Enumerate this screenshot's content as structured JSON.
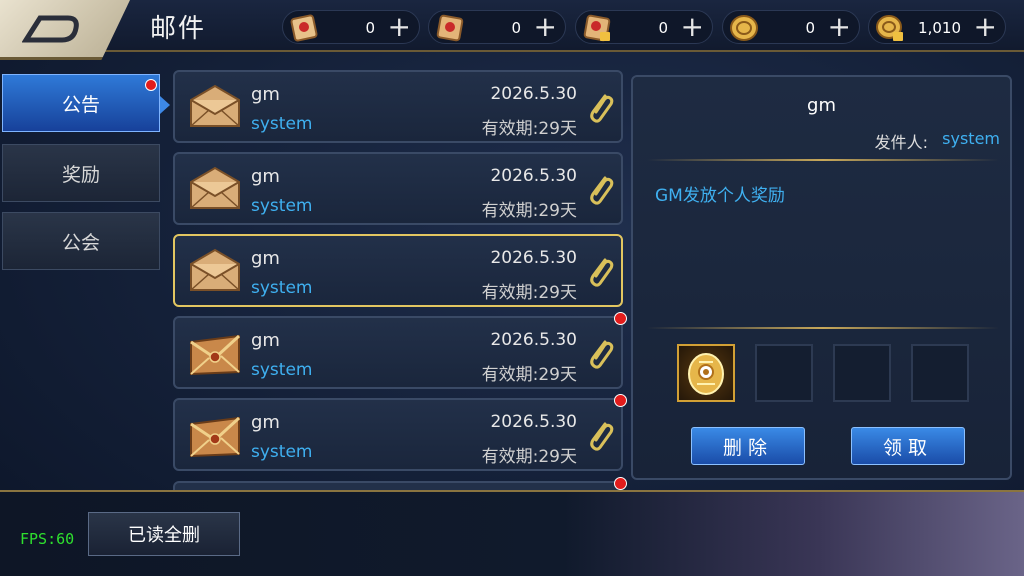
{
  "header": {
    "title": "邮件",
    "resources": [
      {
        "icon": "red-scroll-icon",
        "value": "0"
      },
      {
        "icon": "red-ticket-icon",
        "value": "0"
      },
      {
        "icon": "locked-ticket-icon",
        "value": "0"
      },
      {
        "icon": "gold-coin-icon",
        "value": "0"
      },
      {
        "icon": "locked-gold-coin-icon",
        "value": "1,010"
      }
    ],
    "plus": "+"
  },
  "tabs": [
    {
      "label": "公告",
      "active": true,
      "badge": true
    },
    {
      "label": "奖励",
      "active": false,
      "badge": false
    },
    {
      "label": "公会",
      "active": false,
      "badge": false
    }
  ],
  "mails": [
    {
      "sender": "gm",
      "from": "system",
      "date": "2026.5.30",
      "expiry": "有效期:29天",
      "envelope": "plain",
      "selected": false,
      "badge": false
    },
    {
      "sender": "gm",
      "from": "system",
      "date": "2026.5.30",
      "expiry": "有效期:29天",
      "envelope": "plain",
      "selected": false,
      "badge": false
    },
    {
      "sender": "gm",
      "from": "system",
      "date": "2026.5.30",
      "expiry": "有效期:29天",
      "envelope": "plain",
      "selected": true,
      "badge": false
    },
    {
      "sender": "gm",
      "from": "system",
      "date": "2026.5.30",
      "expiry": "有效期:29天",
      "envelope": "sealed",
      "selected": false,
      "badge": true
    },
    {
      "sender": "gm",
      "from": "system",
      "date": "2026.5.30",
      "expiry": "有效期:29天",
      "envelope": "sealed",
      "selected": false,
      "badge": true
    }
  ],
  "detail": {
    "title": "gm",
    "sender_label": "发件人:",
    "sender": "system",
    "body": "GM发放个人奖励",
    "attachments": [
      "gold-emblem-icon",
      "",
      "",
      ""
    ],
    "delete_label": "删除",
    "claim_label": "领取"
  },
  "footer": {
    "fps": "FPS:60",
    "delete_read_label": "已读全删"
  },
  "colors": {
    "accent_blue": "#3fb0f0",
    "selected_border": "#e2c661",
    "badge_red": "#e21c1c"
  }
}
